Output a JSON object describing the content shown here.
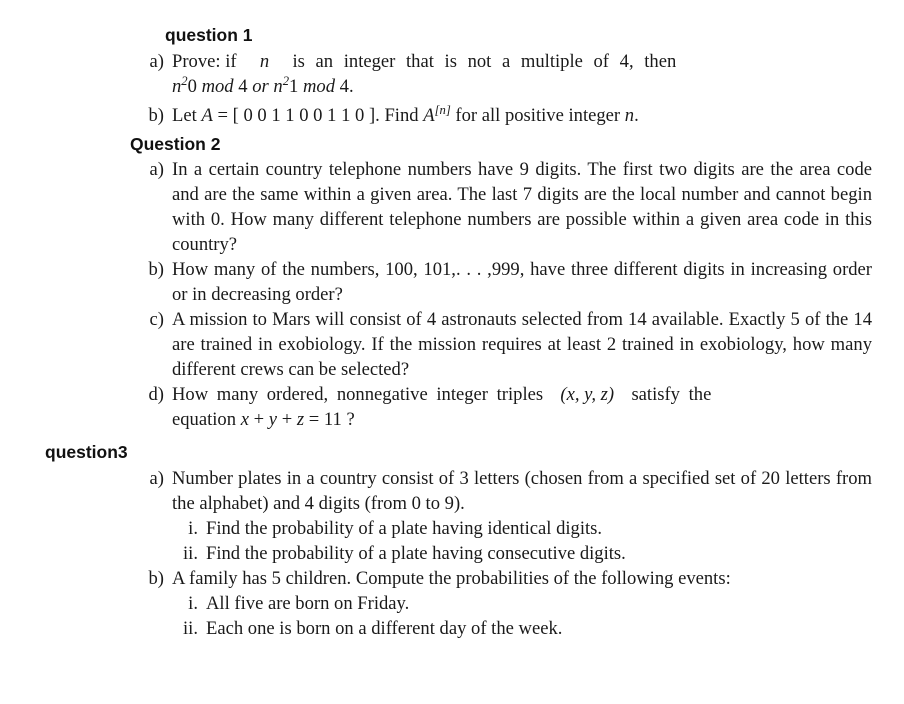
{
  "document": {
    "sections": [
      {
        "heading": "question 1",
        "heading_style": "indent-a",
        "items": [
          {
            "marker": "a)",
            "lines": [
              "Prove: if n is an integer that is not a multiple of 4, then",
              "n²0 mod 4 or n²1 mod 4 ."
            ],
            "text": "Prove: if n is an integer that is not a multiple of 4, then n²0 mod 4 or n²1 mod 4 ."
          },
          {
            "marker": "b)",
            "lines": [
              "Let A = [ 0 0 1 1 0 0 1 1 0 ] . Find A[n] for all positive integer n ."
            ],
            "text": "Let A = [0 0 1 1 0 0 1 1 0 ]. Find A[n] for all positive integer n ."
          }
        ]
      },
      {
        "heading": "Question 2",
        "heading_style": "indent-b",
        "items": [
          {
            "marker": "a)",
            "text": "In a certain country telephone numbers have 9 digits. The first two digits are the area code and are the same within a given area. The last 7 digits are the local number and cannot begin with 0. How many different telephone numbers are possible within a given area code in this country?"
          },
          {
            "marker": "b)",
            "text": "How many of the numbers, 100, 101,. . . ,999, have three different digits in increasing order or in decreasing order?"
          },
          {
            "marker": "c)",
            "text": "A mission to Mars will consist of 4 astronauts selected from 14 available. Exactly 5 of the 14 are trained in exobiology. If the mission requires at least 2 trained in exobiology, how many different crews can be selected?"
          },
          {
            "marker": "d)",
            "text": "How many ordered, nonnegative integer triples (x, y, z) satisfy the equation x + y + z = 11 ?"
          }
        ]
      },
      {
        "heading": "question3",
        "heading_style": "indent-c",
        "items": [
          {
            "marker": "a)",
            "text": "Number plates in a country consist of 3 letters (chosen from a specified set of 20 letters from the alphabet) and 4 digits (from 0 to 9).",
            "subitems": [
              {
                "marker": "i.",
                "text": "Find the probability of a plate having identical digits."
              },
              {
                "marker": "ii.",
                "text": "Find the probability of a plate having consecutive digits."
              }
            ]
          },
          {
            "marker": "b)",
            "text": "A family has 5 children. Compute the probabilities of the following events:",
            "subitems": [
              {
                "marker": "i.",
                "text": "All five are born on Friday."
              },
              {
                "marker": "ii.",
                "text": "Each one is born on a different day of the week."
              }
            ]
          }
        ]
      }
    ],
    "math": {
      "q1a_line1": "Prove: if",
      "q1a_var": "n",
      "q1a_line1_rest": "is an integer that is not a multiple of 4, then",
      "q1a_line2_a": "0",
      "q1a_mod": "mod",
      "q1a_four": "4",
      "q1a_or": "or",
      "q1a_line2_b": "1",
      "q1a_period": ".",
      "q1b_pre": "Let",
      "q1b_A": "A",
      "q1b_eq": "=",
      "q1b_matrix": "[ 0 0 1 1 0 0 1 1 0 ]",
      "q1b_dot": ".",
      "q1b_find": "Find",
      "q1b_A2": "A",
      "q1b_sup": "[n]",
      "q1b_rest": "for all positive integer",
      "q1b_var": "n",
      "q1b_end": ".",
      "q2d_pre": "How  many  ordered,  nonnegative  integer  triples",
      "q2d_triple": "(x, y, z)",
      "q2d_post": "satisfy  the",
      "q2d_eq_pre": "equation",
      "q2d_x": "x",
      "q2d_plus1": "+",
      "q2d_y": "y",
      "q2d_plus2": "+",
      "q2d_z": "z",
      "q2d_equals": "=",
      "q2d_val": "11 ?"
    }
  }
}
